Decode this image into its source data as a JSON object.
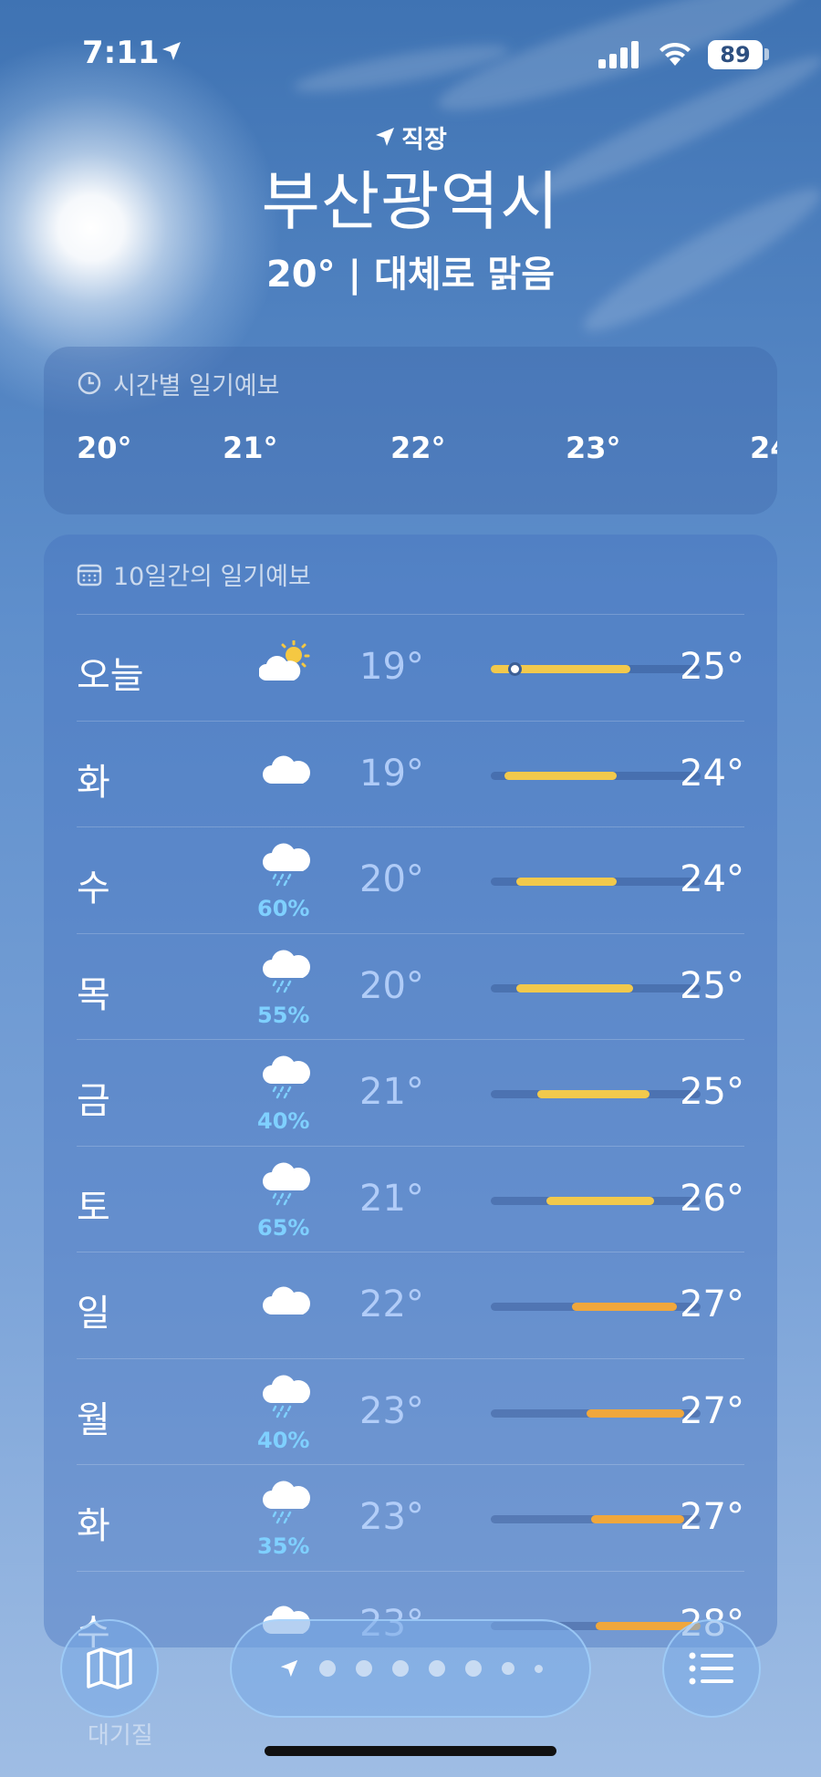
{
  "status_bar": {
    "time": "7:11",
    "battery": "89",
    "location_icon": "location-arrow-icon",
    "signal_icon": "cellular-signal-icon",
    "wifi_icon": "wifi-icon"
  },
  "header": {
    "place_tag": "직장",
    "city": "부산광역시",
    "summary": "20° | 대체로 맑음"
  },
  "hourly": {
    "title": "시간별 일기예보",
    "icon": "clock-icon",
    "temps": [
      "20°",
      "21°",
      "22°",
      "23°",
      "24"
    ]
  },
  "ten_day": {
    "title": "10일간의 일기예보",
    "icon": "calendar-icon",
    "range_min": 19,
    "range_max": 28,
    "current_temp": 20,
    "days": [
      {
        "day": "오늘",
        "icon": "partly-sunny-icon",
        "pop": "",
        "low": "19°",
        "high": "25°",
        "low_v": 19,
        "high_v": 25,
        "color": "#f2c94c"
      },
      {
        "day": "화",
        "icon": "cloud-icon",
        "pop": "",
        "low": "19°",
        "high": "24°",
        "low_v": 19.6,
        "high_v": 24.4,
        "color": "#f2c94c"
      },
      {
        "day": "수",
        "icon": "cloud-rain-icon",
        "pop": "60%",
        "low": "20°",
        "high": "24°",
        "low_v": 20.1,
        "high_v": 24.4,
        "color": "#f2c94c"
      },
      {
        "day": "목",
        "icon": "cloud-rain-icon",
        "pop": "55%",
        "low": "20°",
        "high": "25°",
        "low_v": 20.1,
        "high_v": 25.1,
        "color": "#f2c94c"
      },
      {
        "day": "금",
        "icon": "cloud-rain-icon",
        "pop": "40%",
        "low": "21°",
        "high": "25°",
        "low_v": 21.0,
        "high_v": 25.8,
        "color": "#f2c94c"
      },
      {
        "day": "토",
        "icon": "cloud-rain-icon",
        "pop": "65%",
        "low": "21°",
        "high": "26°",
        "low_v": 21.4,
        "high_v": 26.0,
        "color": "#f2c94c"
      },
      {
        "day": "일",
        "icon": "cloud-icon",
        "pop": "",
        "low": "22°",
        "high": "27°",
        "low_v": 22.5,
        "high_v": 27.0,
        "color": "#f0a73c"
      },
      {
        "day": "월",
        "icon": "cloud-rain-icon",
        "pop": "40%",
        "low": "23°",
        "high": "27°",
        "low_v": 23.1,
        "high_v": 27.3,
        "color": "#f0a73c"
      },
      {
        "day": "화",
        "icon": "cloud-rain-icon",
        "pop": "35%",
        "low": "23°",
        "high": "27°",
        "low_v": 23.3,
        "high_v": 27.3,
        "color": "#f0a73c"
      },
      {
        "day": "수",
        "icon": "cloud-icon",
        "pop": "",
        "low": "23°",
        "high": "28°",
        "low_v": 23.5,
        "high_v": 28.0,
        "color": "#f0a73c"
      }
    ]
  },
  "air_quality_label": "대기질",
  "toolbar": {
    "map_icon": "map-icon",
    "list_icon": "list-icon",
    "pager_icon": "location-arrow-icon"
  }
}
